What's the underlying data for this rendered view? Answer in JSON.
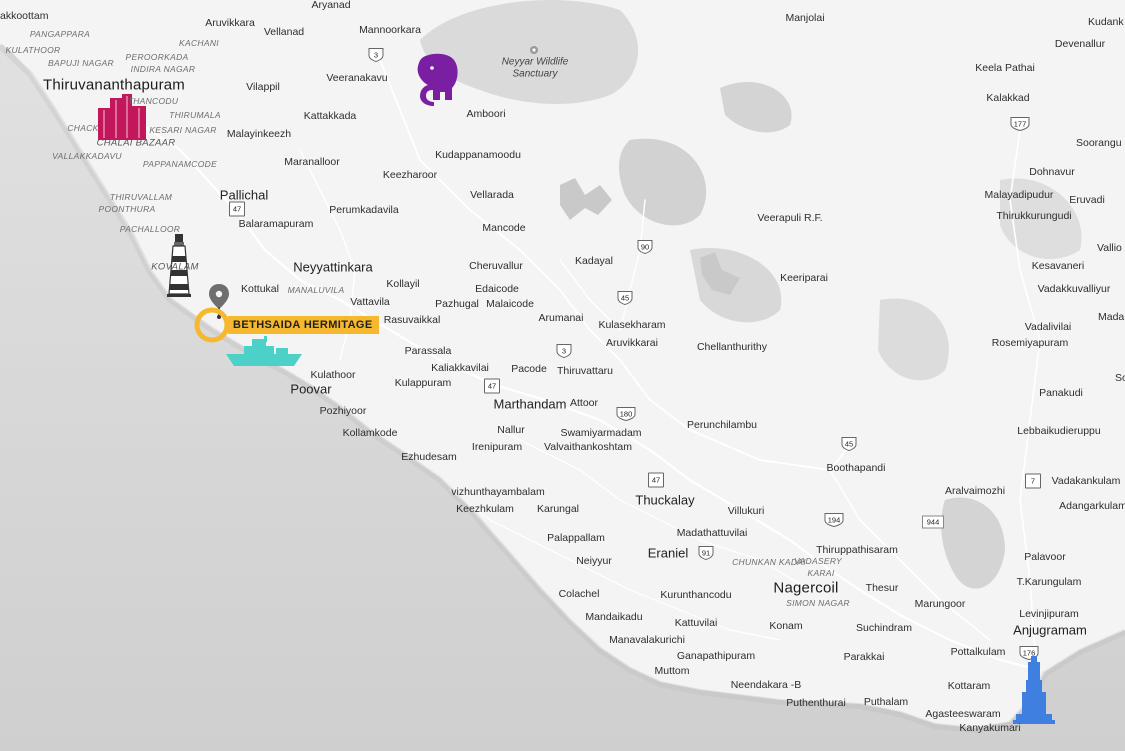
{
  "map": {
    "labels": {
      "kakkoottam": "akkoottam",
      "aruvikkara": "Aruvikkara",
      "aryanad": "Aryanad",
      "mannoorkara": "Mannoorkara",
      "manjolai": "Manjolai",
      "kudankulam": "Kudank",
      "devenallur": "Devenallur",
      "pangappara": "PANGAPPARA",
      "kachani": "KACHANI",
      "vellanad": "Vellanad",
      "kulathoor_n": "KULATHOOR",
      "peroorkada": "PEROORKADA",
      "indira_nagar": "INDIRA NAGAR",
      "bapuji_nagar": "BAPUJI NAGAR",
      "thiruvananthapuram": "Thiruvananthapuram",
      "vilappil": "Vilappil",
      "veeranakavu": "Veeranakavu",
      "keela_pathai": "Keela Pathai",
      "nalanchira_frag": "THANCODU",
      "thirumala": "THIRUMALA",
      "chack": "CHACK",
      "kesari_nagar": "KESARI NAGAR",
      "nam": "NAM",
      "kattakkada": "Kattakkada",
      "amboori": "Amboori",
      "kalakkad": "Kalakkad",
      "malayinkeezh": "Malayinkeezh",
      "chalai_bazaar": "CHALAI BAZAAR",
      "vallakkadavu": "VALLAKKADAVU",
      "pappanamcode": "PAPPANAMCODE",
      "kudappanamoodu": "Kudappanamoodu",
      "maranalloor": "Maranalloor",
      "sooranguri": "Soorangu",
      "keezharoor": "Keezharoor",
      "dohnavur": "Dohnavur",
      "pallichal": "Pallichal",
      "vellarada": "Vellarada",
      "thiruvallam": "THIRUVALLAM",
      "poonthura": "POONTHURA",
      "perumkadavila": "Perumkadavila",
      "malayadipudur": "Malayadipudur",
      "eruvadi": "Eruvadi",
      "thirukkurungudi": "Thirukkurungudi",
      "balaramapuram": "Balaramapuram",
      "veerapuli": "Veerapuli R.F.",
      "mancode": "Mancode",
      "pachalloor": "PACHALLOOR",
      "valliyoor": "Vallio",
      "neyyattinkara": "Neyyattinkara",
      "cheruvallur": "Cheruvallur",
      "kadayal": "Kadayal",
      "kesavaneri": "Kesavaneri",
      "kovalam": "KOVALAM",
      "keeriparai": "Keeriparai",
      "kottukal": "Kottukal",
      "manaluvila": "MANALUVILA",
      "kollayil": "Kollayil",
      "edaicode": "Edaicode",
      "vadakkuvalliyur": "Vadakkuvalliyur",
      "vattavila": "Vattavila",
      "pazhugal": "Pazhugal",
      "malaicode": "Malaicode",
      "kulasekharam": "Kulasekharam",
      "arumanai": "Arumanai",
      "madan": "Mada",
      "hermitage": "BETHSAIDA HERMITAGE",
      "rasuvaikkal": "Rasuvaikkal",
      "vadalivilai": "Vadalivilai",
      "aruvikkarai": "Aruvikkarai",
      "chellanthurithy": "Chellanthurithy",
      "rosemiyapuram": "Rosemiyapuram",
      "parassala": "Parassala",
      "pacode": "Pacode",
      "thiruvattaru": "Thiruvattaru",
      "kaliakkavilai": "Kaliakkavilai",
      "kulathoor_s": "Kulathoor",
      "poovar": "Poovar",
      "kulappuram": "Kulappuram",
      "panakudi": "Panakudi",
      "soundarapandi": "So",
      "marthandam": "Marthandam",
      "attoor": "Attoor",
      "pozhiyoor": "Pozhiyoor",
      "perunchilambu": "Perunchilambu",
      "nallur": "Nallur",
      "kollamkode": "Kollamkode",
      "swamiyarmadam": "Swamiyarmadam",
      "lebbaikudieruppu": "Lebbaikudieruppu",
      "irenipuram": "Irenipuram",
      "valvaithankoshtam": "Valvaithankoshtam",
      "boothapandi": "Boothapandi",
      "ezhudesam": "Ezhudesam",
      "vadakankulam": "Vadakankulam",
      "aralvaimozhi": "Aralvaimozhi",
      "vizhunthayambalam": "vizhunthayambalam",
      "thuckalay": "Thuckalay",
      "adangarkulam": "Adangarkulam",
      "keezhkulam": "Keezhkulam",
      "karungal": "Karungal",
      "villukuri": "Villukuri",
      "madathattuvilai": "Madathattuvilai",
      "palappallam": "Palappallam",
      "chunkankadai": "CHUNKAN KADAI",
      "thiruppathisaram": "Thiruppathisaram",
      "eraniel": "Eraniel",
      "palavoor": "Palavoor",
      "neiyyur": "Neiyyur",
      "vadasery_karai": "KARAI",
      "vadasery": "VADASERY",
      "nagercoil": "Nagercoil",
      "thesur": "Thesur",
      "colachel": "Colachel",
      "kurunthancodu": "Kurunthancodu",
      "tkarungulam": "T.Karungulam",
      "simon_nagar": "SIMON NAGAR",
      "marungoor": "Marungoor",
      "mandaikadu": "Mandaikadu",
      "levinjipuram": "Levinjipuram",
      "kattuvilai": "Kattuvilai",
      "konam": "Konam",
      "suchindram": "Suchindram",
      "anjugramam": "Anjugramam",
      "manavalakurichi": "Manavalakurichi",
      "pottalkulam": "Pottalkulam",
      "ganapathipuram": "Ganapathipuram",
      "parakkai": "Parakkai",
      "muttom": "Muttom",
      "kottaram": "Kottaram",
      "neendakara": "Neendakara -B",
      "puthenthurai": "Puthenthurai",
      "puthalam": "Puthalam",
      "agasteeswaram": "Agasteeswaram",
      "kanyakumari": "Kanyakumari",
      "neyyar": "Neyyar Wildlife\nSanctuary"
    },
    "road_shields": [
      {
        "id": "r3a",
        "text": "3",
        "shape": "shield"
      },
      {
        "id": "r47a",
        "text": "47",
        "shape": "square"
      },
      {
        "id": "r90",
        "text": "90",
        "shape": "shield"
      },
      {
        "id": "r45a",
        "text": "45",
        "shape": "shield"
      },
      {
        "id": "r3b",
        "text": "3",
        "shape": "shield"
      },
      {
        "id": "r47b",
        "text": "47",
        "shape": "square"
      },
      {
        "id": "r180",
        "text": "180",
        "shape": "shield"
      },
      {
        "id": "r45b",
        "text": "45",
        "shape": "shield"
      },
      {
        "id": "r47c",
        "text": "47",
        "shape": "square"
      },
      {
        "id": "r91",
        "text": "91",
        "shape": "shield"
      },
      {
        "id": "r194",
        "text": "194",
        "shape": "shield"
      },
      {
        "id": "r944",
        "text": "944",
        "shape": "rect"
      },
      {
        "id": "r7",
        "text": "7",
        "shape": "square"
      },
      {
        "id": "r177",
        "text": "177",
        "shape": "shield"
      },
      {
        "id": "r176",
        "text": "176",
        "shape": "shield"
      }
    ],
    "markers": {
      "hermitage_pin_color": "#6e6e6e",
      "hermitage_ring_color": "#f5b82e",
      "city_icon_color": "#c2185b",
      "elephant_color": "#7b1fa2",
      "lighthouse_color": "#333333",
      "boat_color": "#4dd0c8",
      "kanyakumari_monument_color": "#3f7fe0"
    },
    "colors": {
      "land": "#f4f4f4",
      "sea": "#d9d9d9",
      "hills": "#d6d6d6",
      "road": "#ffffff"
    }
  }
}
